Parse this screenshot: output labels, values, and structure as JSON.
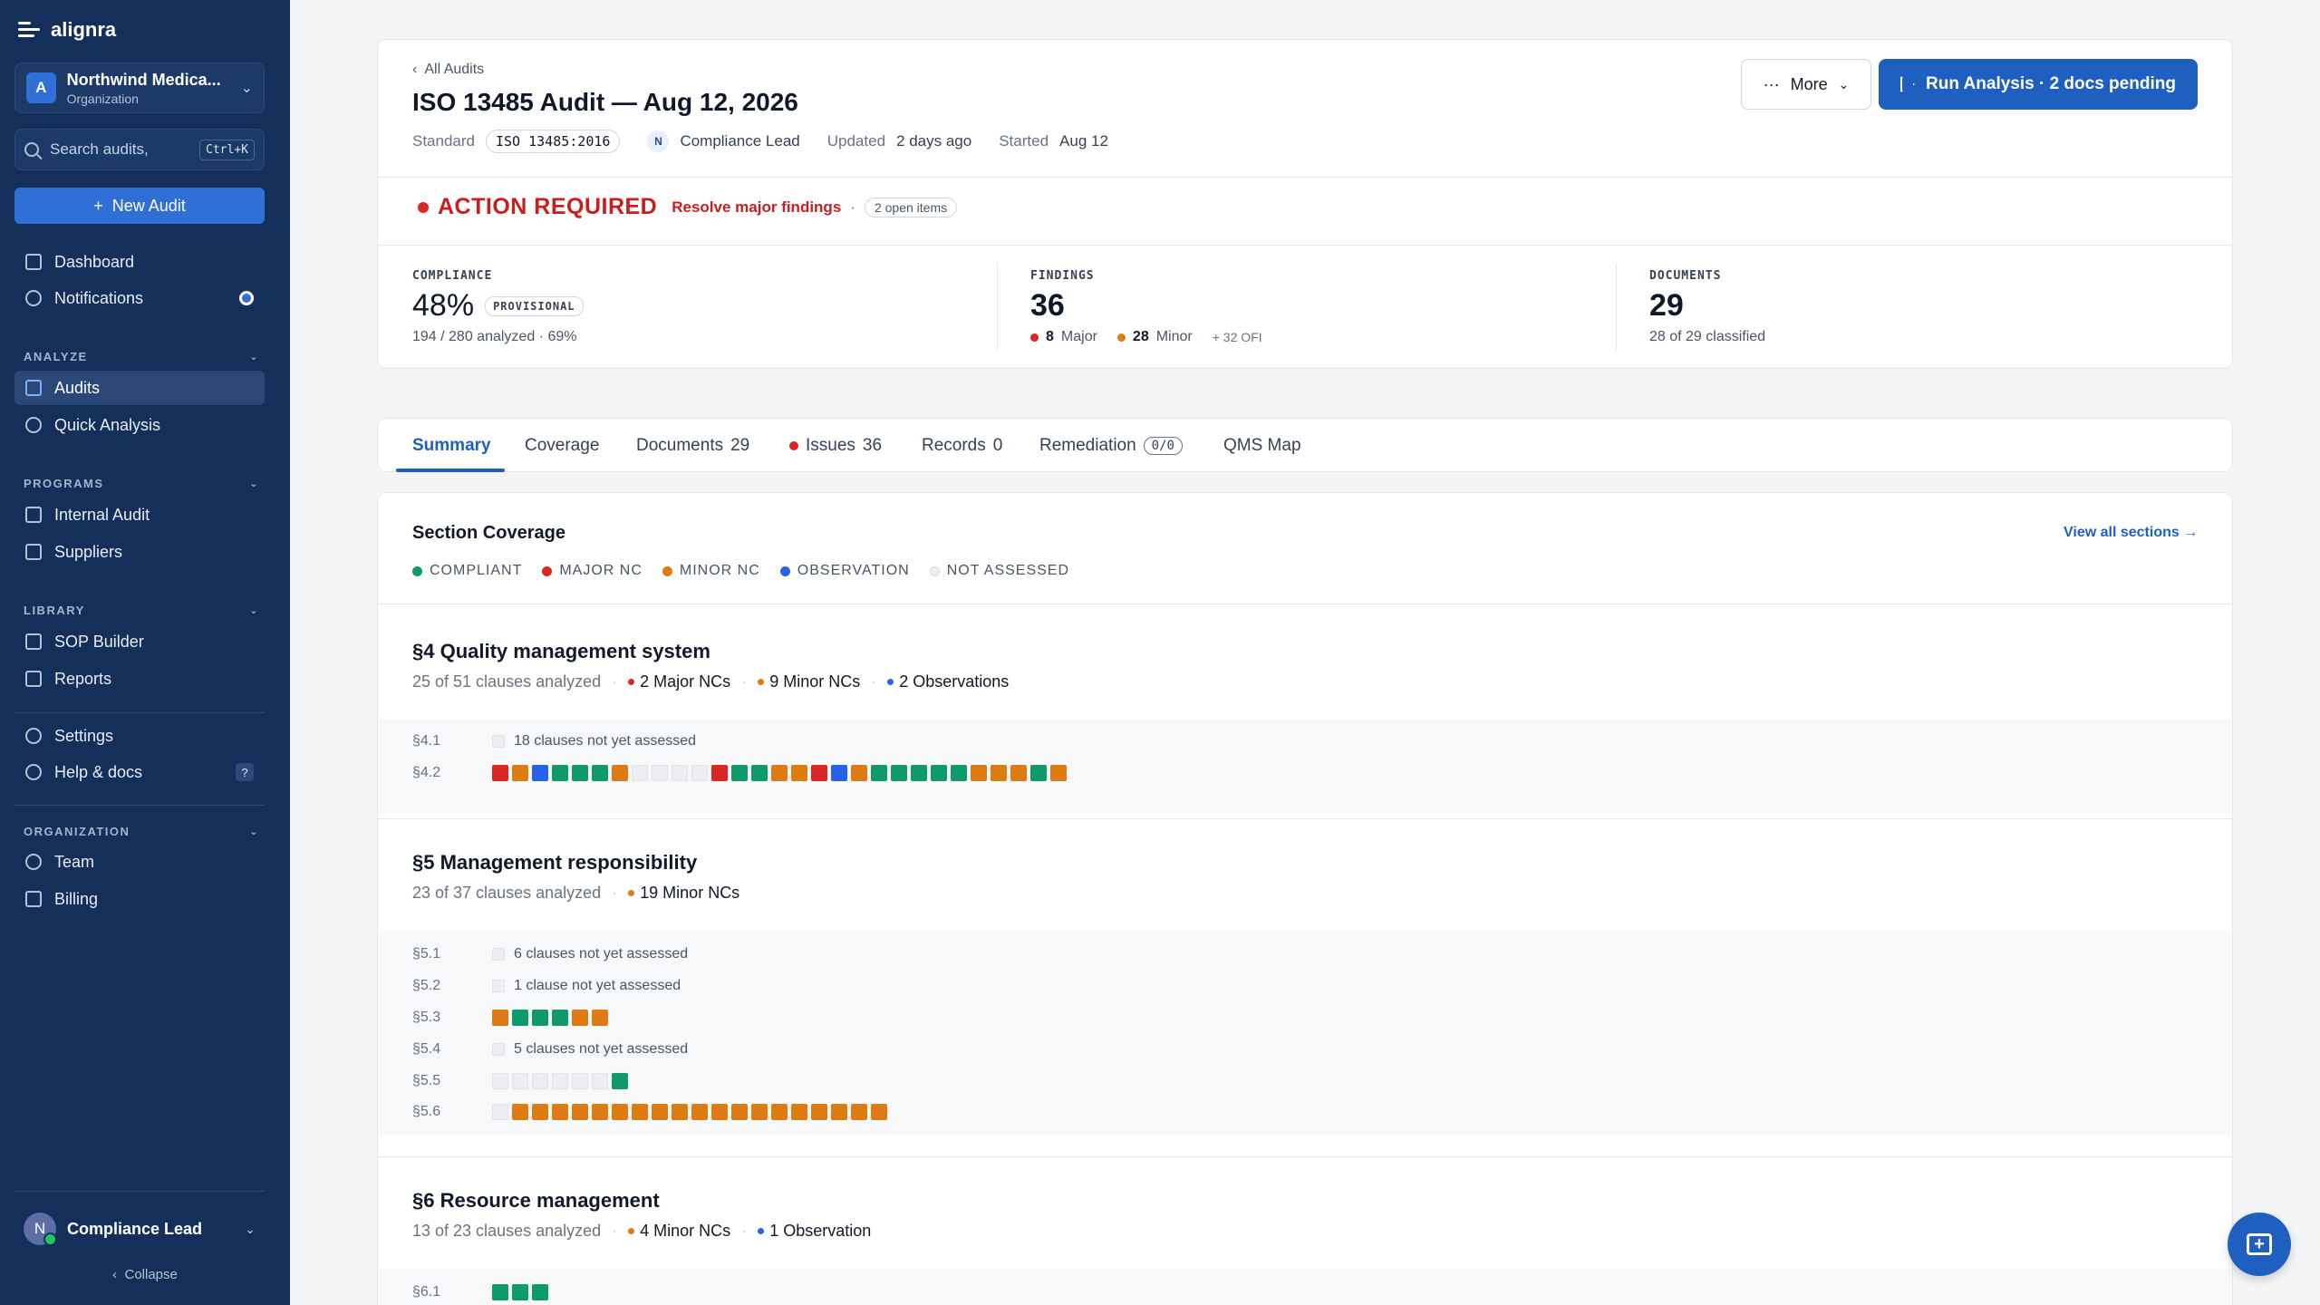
{
  "app": {
    "name": "alignra"
  },
  "org": {
    "name": "Northwind Medica...",
    "sub": "Organization",
    "initial": "A"
  },
  "search": {
    "placeholder": "Search audits,",
    "shortcut": "Ctrl+K"
  },
  "new_audit": "New Audit",
  "nav": {
    "dashboard": "Dashboard",
    "notifications": "Notifications",
    "analyze": "ANALYZE",
    "audits": "Audits",
    "quick_analysis": "Quick Analysis",
    "programs": "PROGRAMS",
    "internal_audit": "Internal Audit",
    "suppliers": "Suppliers",
    "library": "LIBRARY",
    "sop_builder": "SOP Builder",
    "reports": "Reports",
    "settings": "Settings",
    "help": "Help & docs",
    "help_key": "?",
    "organization": "ORGANIZATION",
    "team": "Team",
    "billing": "Billing"
  },
  "user": {
    "name": "Compliance Lead",
    "initial": "N"
  },
  "collapse": "Collapse",
  "header": {
    "breadcrumb": "All Audits",
    "title": "ISO 13485 Audit — Aug 12, 2026",
    "standard_label": "Standard",
    "standard": "ISO 13485:2016",
    "owner_initial": "N",
    "owner": "Compliance Lead",
    "updated_label": "Updated",
    "updated": "2 days ago",
    "started_label": "Started",
    "started": "Aug 12",
    "more": "More",
    "run": "Run Analysis · 2 docs pending"
  },
  "status": {
    "title": "ACTION REQUIRED",
    "sub": "Resolve major findings",
    "sep": "·",
    "open": "2 open items"
  },
  "stats": {
    "compliance": {
      "label": "COMPLIANCE",
      "value": "48%",
      "badge": "PROVISIONAL",
      "sub": "194 / 280 analyzed · 69%"
    },
    "findings": {
      "label": "FINDINGS",
      "value": "36",
      "major_n": "8",
      "major": "Major",
      "minor_n": "28",
      "minor": "Minor",
      "ofi": "+ 32 OFI"
    },
    "documents": {
      "label": "DOCUMENTS",
      "value": "29",
      "sub": "28 of 29 classified"
    }
  },
  "tabs": {
    "summary": "Summary",
    "coverage": "Coverage",
    "documents": "Documents",
    "documents_count": "29",
    "issues": "Issues",
    "issues_count": "36",
    "records": "Records",
    "records_count": "0",
    "remediation": "Remediation",
    "remediation_count": "0/0",
    "qms": "QMS Map"
  },
  "coverage": {
    "title": "Section Coverage",
    "view_all": "View all sections →",
    "legend": {
      "compliant": "COMPLIANT",
      "major": "MAJOR NC",
      "minor": "MINOR NC",
      "observation": "OBSERVATION",
      "not_assessed": "NOT ASSESSED"
    },
    "colors": {
      "compliant": "#0e9a6a",
      "major": "#dc2626",
      "minor": "#de7b12",
      "observation": "#2563eb",
      "not_assessed": "#eceef1"
    },
    "sections": [
      {
        "title": "§4 Quality management system",
        "analyzed": "25 of 51 clauses analyzed",
        "tags": [
          {
            "text": "2 Major NCs",
            "color": "#dc2626"
          },
          {
            "text": "9 Minor NCs",
            "color": "#de7b12"
          },
          {
            "text": "2 Observations",
            "color": "#2563eb"
          }
        ],
        "rows": [
          {
            "label": "§4.1",
            "note": "18 clauses not yet assessed",
            "cells": "n"
          },
          {
            "label": "§4.2",
            "note": "",
            "cells": "robgggonnnnrggoorbogggggooog o"
          }
        ]
      },
      {
        "title": "§5 Management responsibility",
        "analyzed": "23 of 37 clauses analyzed",
        "tags": [
          {
            "text": "19 Minor NCs",
            "color": "#de7b12"
          }
        ],
        "rows": [
          {
            "label": "§5.1",
            "note": "6 clauses not yet assessed",
            "cells": "n"
          },
          {
            "label": "§5.2",
            "note": "1 clause not yet assessed",
            "cells": "n"
          },
          {
            "label": "§5.3",
            "note": "",
            "cells": "ogggoo"
          },
          {
            "label": "§5.4",
            "note": "5 clauses not yet assessed",
            "cells": "n"
          },
          {
            "label": "§5.5",
            "note": "",
            "cells": "nnnnnng"
          },
          {
            "label": "§5.6",
            "note": "",
            "cells": "nooooooooooooooooooo"
          }
        ]
      },
      {
        "title": "§6 Resource management",
        "analyzed": "13 of 23 clauses analyzed",
        "tags": [
          {
            "text": "4 Minor NCs",
            "color": "#de7b12"
          },
          {
            "text": "1 Observation",
            "color": "#2563eb"
          }
        ],
        "rows": [
          {
            "label": "§6.1",
            "note": "",
            "cells": "ggg"
          }
        ]
      }
    ]
  }
}
